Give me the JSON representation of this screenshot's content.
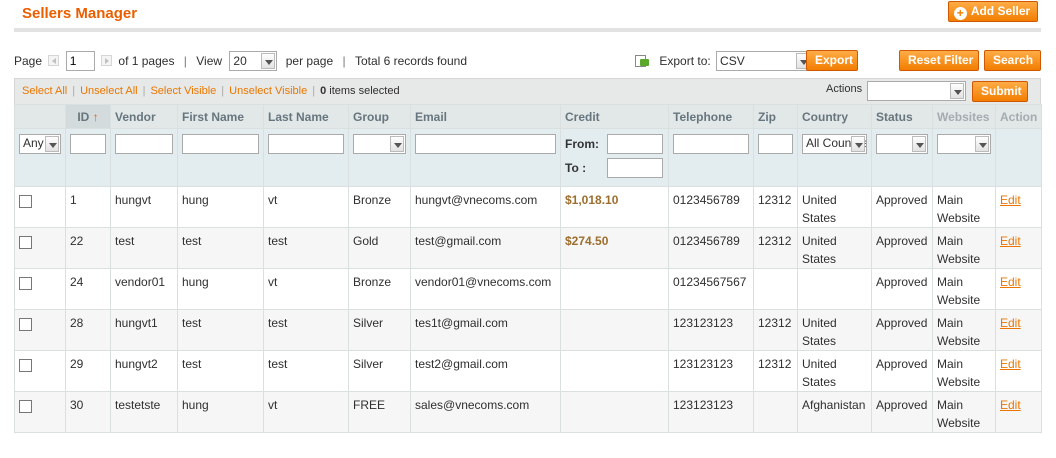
{
  "header": {
    "title": "Sellers Manager",
    "add_label": "Add Seller"
  },
  "pager": {
    "page_label": "Page",
    "page_value": "1",
    "of_pages": "of 1 pages",
    "view_label": "View",
    "per_page_value": "20",
    "per_page_label": "per page",
    "total": "Total 6 records found"
  },
  "export": {
    "label": "Export to:",
    "format": "CSV",
    "button": "Export"
  },
  "buttons": {
    "reset": "Reset Filter",
    "search": "Search",
    "submit": "Submit"
  },
  "massaction": {
    "select_all": "Select All",
    "unselect_all": "Unselect All",
    "select_visible": "Select Visible",
    "unselect_visible": "Unselect Visible",
    "items_count": "0",
    "items_selected": " items selected",
    "actions_label": "Actions"
  },
  "columns": {
    "id": "ID",
    "vendor": "Vendor",
    "first_name": "First Name",
    "last_name": "Last Name",
    "group": "Group",
    "email": "Email",
    "credit": "Credit",
    "telephone": "Telephone",
    "zip": "Zip",
    "country": "Country",
    "status": "Status",
    "websites": "Websites",
    "action": "Action"
  },
  "filters": {
    "checkbox": "Any",
    "credit_from": "From:",
    "credit_to": "To :",
    "country": "All Countries"
  },
  "rows": [
    {
      "id": "1",
      "vendor": "hungvt",
      "first": "hung",
      "last": "vt",
      "group": "Bronze",
      "email": "hungvt@vnecoms.com",
      "credit": "$1,018.10",
      "phone": "0123456789",
      "zip": "12312",
      "country": "United States",
      "status": "Approved",
      "website": "Main Website",
      "action": "Edit"
    },
    {
      "id": "22",
      "vendor": "test",
      "first": "test",
      "last": "test",
      "group": "Gold",
      "email": "test@gmail.com",
      "credit": "$274.50",
      "phone": "0123456789",
      "zip": "12312",
      "country": "United States",
      "status": "Approved",
      "website": "Main Website",
      "action": "Edit"
    },
    {
      "id": "24",
      "vendor": "vendor01",
      "first": "hung",
      "last": "vt",
      "group": "Bronze",
      "email": "vendor01@vnecoms.com",
      "credit": "",
      "phone": "01234567567",
      "zip": "",
      "country": "",
      "status": "Approved",
      "website": "Main Website",
      "action": "Edit"
    },
    {
      "id": "28",
      "vendor": "hungvt1",
      "first": "test",
      "last": "test",
      "group": "Silver",
      "email": "tes1t@gmail.com",
      "credit": "",
      "phone": "123123123",
      "zip": "12312",
      "country": "United States",
      "status": "Approved",
      "website": "Main Website",
      "action": "Edit"
    },
    {
      "id": "29",
      "vendor": "hungvt2",
      "first": "test",
      "last": "test",
      "group": "Silver",
      "email": "test2@gmail.com",
      "credit": "",
      "phone": "123123123",
      "zip": "12312",
      "country": "United States",
      "status": "Approved",
      "website": "Main Website",
      "action": "Edit"
    },
    {
      "id": "30",
      "vendor": "testetste",
      "first": "hung",
      "last": "vt",
      "group": "FREE",
      "email": "sales@vnecoms.com",
      "credit": "",
      "phone": "123123123",
      "zip": "",
      "country": "Afghanistan",
      "status": "Approved",
      "website": "Main Website",
      "action": "Edit"
    }
  ],
  "colors": {
    "accent": "#eb5e00",
    "button": "#f27d00",
    "link": "#ea7601"
  }
}
